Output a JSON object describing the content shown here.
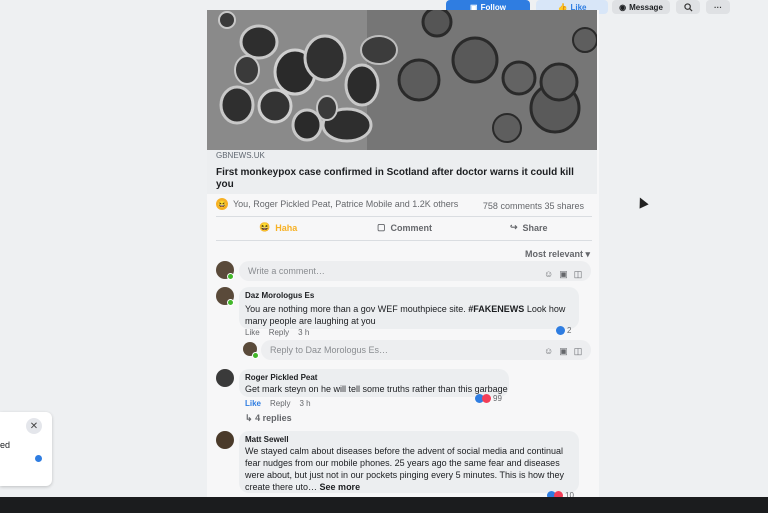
{
  "page_header": {
    "follow_label": "Follow",
    "like_label": "Like",
    "message_label": "Message",
    "search_icon": "search-icon",
    "more_icon": "more-icon"
  },
  "post": {
    "source": "GBNEWS.UK",
    "headline": "First monkeypox case confirmed in Scotland after doctor warns it could kill you",
    "reactors": "You, Roger Pickled Peat, Patrice Mobile and 1.2K others",
    "comments_count": "758 comments",
    "shares_count": "35 shares",
    "actions": {
      "haha": "Haha",
      "comment": "Comment",
      "share": "Share"
    },
    "sort_label": "Most relevant",
    "comment_placeholder": "Write a comment…"
  },
  "comments": [
    {
      "author": "Daz Morologus Es",
      "text_plain": "You are nothing more than a gov WEF mouthpiece site. ",
      "hashtag": "#FAKENEWS",
      "text_tail": " Look how many people are laughing at you",
      "like": "Like",
      "reply": "Reply",
      "time": "3 h",
      "reaction_count": "2",
      "reply_placeholder": "Reply to Daz Morologus Es…"
    },
    {
      "author": "Roger Pickled Peat",
      "text": "Get mark steyn on he will tell some truths rather than this garbage",
      "like": "Like",
      "reply": "Reply",
      "time": "3 h",
      "reaction_count": "99",
      "replies_label": "4 replies"
    },
    {
      "author": "Matt Sewell",
      "text": "We stayed calm about diseases before the advent of social media and continual fear nudges from our mobile phones. 25 years ago the same fear and diseases were about, but just not in our pockets pinging every 5 minutes. This is how they create there uto… ",
      "see_more": "See more",
      "reaction_count": "10"
    }
  ],
  "side_popup": {
    "close_icon": "close-icon",
    "text": "ed"
  },
  "colors": {
    "accent": "#2f7de1",
    "haha": "#f7b125",
    "love": "#f33e58",
    "online": "#42b72a"
  }
}
